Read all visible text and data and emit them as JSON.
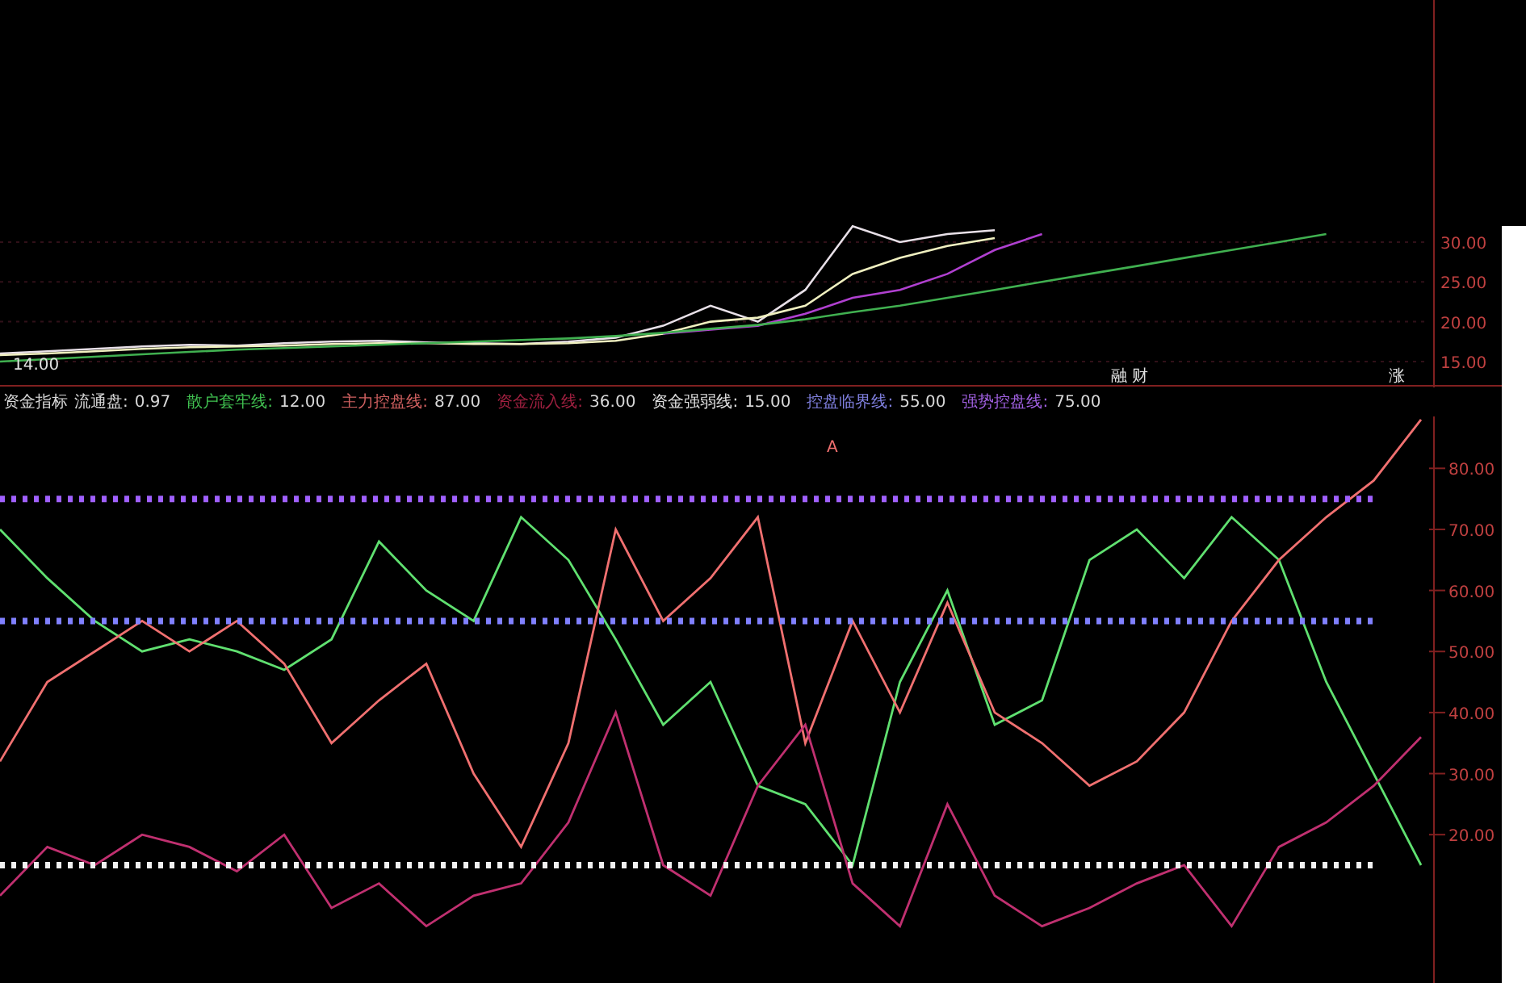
{
  "price_panel": {
    "labels": [
      "14.00",
      "融 财",
      "涨"
    ],
    "chart_data": {
      "type": "line",
      "ylim": [
        11.75,
        60.4
      ],
      "grid": true,
      "yticks": [
        {
          "value": 15,
          "label": "15.00"
        },
        {
          "value": 20,
          "label": "20.00"
        },
        {
          "value": 25,
          "label": "25.00"
        },
        {
          "value": 30,
          "label": "30.00"
        }
      ],
      "series": [
        {
          "color": "#e8e0e8",
          "values": [
            16,
            16.3,
            16.6,
            16.9,
            17.1,
            17.0,
            17.3,
            17.5,
            17.6,
            17.4,
            17.3,
            17.2,
            17.5,
            18,
            19.5,
            22,
            20,
            24,
            32,
            30,
            31,
            31.5,
            null,
            null,
            null,
            null,
            null,
            null,
            null,
            null,
            null
          ]
        },
        {
          "color": "#f0f0c0",
          "values": [
            15.8,
            16,
            16.3,
            16.6,
            16.8,
            16.9,
            17.0,
            17.2,
            17.3,
            17.3,
            17.2,
            17.2,
            17.3,
            17.6,
            18.5,
            20,
            20.5,
            22,
            26,
            28,
            29.5,
            30.5,
            null,
            null,
            null,
            null,
            null,
            null,
            null,
            null,
            null
          ]
        },
        {
          "color": "#b040d0",
          "values": [
            null,
            null,
            null,
            null,
            null,
            null,
            null,
            null,
            null,
            null,
            null,
            null,
            null,
            null,
            18.5,
            19,
            19.5,
            21,
            23,
            24,
            26,
            29,
            31,
            null,
            null,
            null,
            null,
            null,
            null,
            null,
            null
          ]
        },
        {
          "color": "#40b050",
          "values": [
            15,
            15.3,
            15.6,
            15.9,
            16.2,
            16.5,
            16.7,
            16.9,
            17.1,
            17.3,
            17.5,
            17.7,
            17.9,
            18.2,
            18.6,
            19.1,
            19.6,
            20.3,
            21.2,
            22,
            23,
            24,
            25,
            26,
            27,
            28,
            29,
            30,
            31,
            null,
            null
          ]
        }
      ]
    }
  },
  "indicator_bar": {
    "title": "资金指标",
    "items": [
      {
        "label": "流通盘:",
        "value": "0.97",
        "color": "#d8d8d8"
      },
      {
        "label": "散户套牢线:",
        "value": "12.00",
        "color": "#40c050"
      },
      {
        "label": "主力控盘线:",
        "value": "87.00",
        "color": "#d06060"
      },
      {
        "label": "资金流入线:",
        "value": "36.00",
        "color": "#a02040"
      },
      {
        "label": "资金强弱线:",
        "value": "15.00",
        "color": "#e0e0e0"
      },
      {
        "label": "控盘临界线:",
        "value": "55.00",
        "color": "#8080e0"
      },
      {
        "label": "强势控盘线:",
        "value": "75.00",
        "color": "#a060e0"
      }
    ]
  },
  "indicator_panel": {
    "labels": [
      "A"
    ],
    "chart_data": {
      "type": "line",
      "ylim": [
        -4.3,
        88.5
      ],
      "yticks": [
        {
          "value": 20,
          "label": "20.00"
        },
        {
          "value": 30,
          "label": "30.00"
        },
        {
          "value": 40,
          "label": "40.00"
        },
        {
          "value": 50,
          "label": "50.00"
        },
        {
          "value": 60,
          "label": "60.00"
        },
        {
          "value": 70,
          "label": "70.00"
        },
        {
          "value": 80,
          "label": "80.00"
        }
      ],
      "series": [
        {
          "color": "#60e070",
          "values": [
            70,
            62,
            55,
            50,
            52,
            50,
            47,
            52,
            68,
            60,
            55,
            72,
            65,
            52,
            38,
            45,
            28,
            25,
            15,
            45,
            60,
            38,
            42,
            65,
            70,
            62,
            72,
            65,
            45,
            30,
            15
          ]
        },
        {
          "color": "#f07070",
          "values": [
            32,
            45,
            50,
            55,
            50,
            55,
            48,
            35,
            42,
            48,
            30,
            18,
            35,
            70,
            55,
            62,
            72,
            35,
            55,
            40,
            58,
            40,
            35,
            28,
            32,
            40,
            55,
            65,
            72,
            78,
            88
          ]
        },
        {
          "color": "#c03070",
          "values": [
            10,
            18,
            15,
            20,
            18,
            14,
            20,
            8,
            12,
            5,
            10,
            12,
            22,
            40,
            15,
            10,
            28,
            38,
            12,
            5,
            25,
            10,
            5,
            8,
            12,
            15,
            5,
            18,
            22,
            28,
            36
          ]
        },
        {
          "color": "#f0f0f0",
          "line_style": "dotted",
          "values": [
            15,
            15,
            15,
            15,
            15,
            15,
            15,
            15,
            15,
            15,
            15,
            15,
            15,
            15,
            15,
            15,
            15,
            15,
            15,
            15,
            15,
            15,
            15,
            15,
            15,
            15,
            15,
            15,
            15,
            15,
            null
          ]
        },
        {
          "color": "#8080ff",
          "line_style": "dotted",
          "values": [
            55,
            55,
            55,
            55,
            55,
            55,
            55,
            55,
            55,
            55,
            55,
            55,
            55,
            55,
            55,
            55,
            55,
            55,
            55,
            55,
            55,
            55,
            55,
            55,
            55,
            55,
            55,
            55,
            55,
            55,
            null
          ]
        },
        {
          "color": "#a060ff",
          "line_style": "dotted",
          "values": [
            75,
            75,
            75,
            75,
            75,
            75,
            75,
            75,
            75,
            75,
            75,
            75,
            75,
            75,
            75,
            75,
            75,
            75,
            75,
            75,
            75,
            75,
            75,
            75,
            75,
            75,
            75,
            75,
            75,
            75,
            null
          ]
        }
      ]
    }
  }
}
